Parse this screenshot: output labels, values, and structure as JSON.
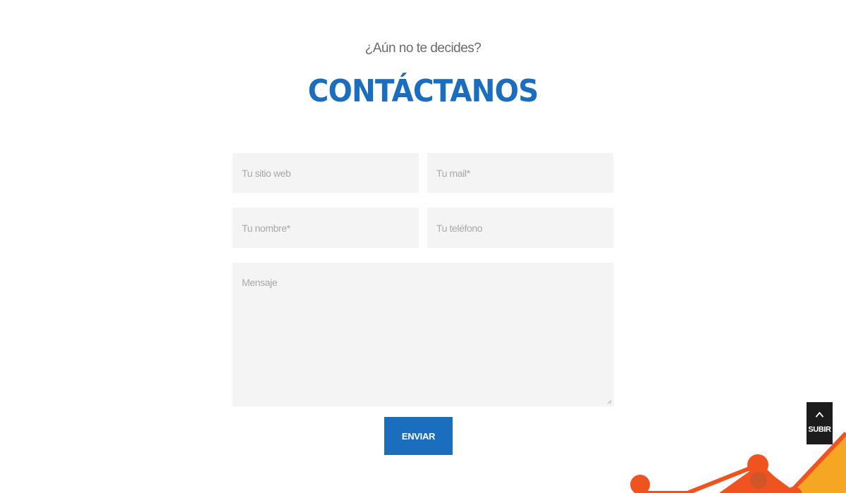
{
  "header": {
    "kicker": "¿Aún no te decides?",
    "title": "CONTÁCTANOS"
  },
  "form": {
    "website_placeholder": "Tu sitio web",
    "email_placeholder": "Tu mail*",
    "name_placeholder": "Tu nombre*",
    "phone_placeholder": "Tu teléfono",
    "message_placeholder": "Mensaje",
    "submit_label": "ENVIAR"
  },
  "scroll_top": {
    "label": "SUBIR",
    "icon": "chevron-up-icon"
  },
  "colors": {
    "brand_blue": "#1b6ebe",
    "field_bg": "#f4f4f4",
    "accent_orange": "#f0531f",
    "accent_yellow": "#f5a623"
  }
}
